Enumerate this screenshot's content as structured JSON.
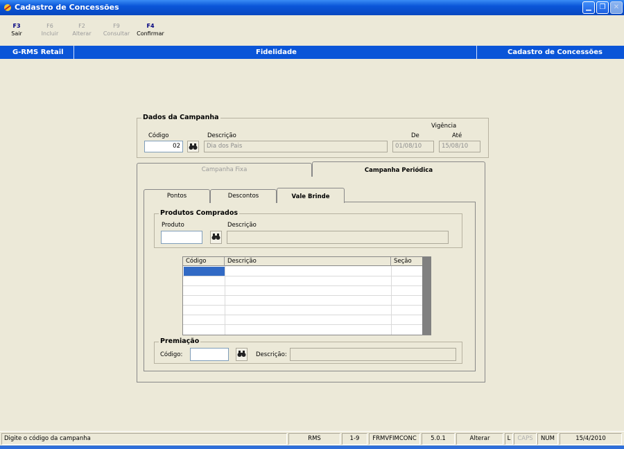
{
  "window": {
    "title": "Cadastro de Concessões"
  },
  "toolbar": {
    "keys": [
      {
        "key": "F3",
        "label": "Sair",
        "enabled": true
      },
      {
        "key": "F6",
        "label": "Incluir",
        "enabled": false
      },
      {
        "key": "F2",
        "label": "Alterar",
        "enabled": false
      },
      {
        "key": "F9",
        "label": "Consultar",
        "enabled": false
      },
      {
        "key": "F4",
        "label": "Confirmar",
        "enabled": true
      }
    ]
  },
  "header": {
    "left": "G-RMS Retail",
    "center": "Fidelidade",
    "right": "Cadastro de Concessões"
  },
  "campaign": {
    "group_title": "Dados da Campanha",
    "codigo_label": "Código",
    "codigo_value": "02",
    "descricao_label": "Descrição",
    "descricao_value": "Dia dos Pais",
    "vigencia_label": "Vigência",
    "de_label": "De",
    "ate_label": "Até",
    "de_value": "01/08/10",
    "ate_value": "15/08/10"
  },
  "tabs": {
    "outer": [
      "Campanha Fixa",
      "Campanha Periódica"
    ],
    "inner": [
      "Pontos",
      "Descontos",
      "Vale Brinde"
    ]
  },
  "produtos": {
    "group_title": "Produtos Comprados",
    "produto_label": "Produto",
    "descricao_label": "Descrição",
    "produto_value": "",
    "descricao_value": ""
  },
  "grid": {
    "columns": [
      "Código",
      "Descrição",
      "Seção"
    ],
    "rows": []
  },
  "premiacao": {
    "group_title": "Premiação",
    "codigo_label": "Código:",
    "descricao_label": "Descrição:",
    "codigo_value": "",
    "descricao_value": ""
  },
  "statusbar": {
    "message": "Digite o código da campanha",
    "system": "RMS",
    "pages": "1-9",
    "form": "FRMVFIMCONC",
    "version": "5.0.1",
    "mode": "Alterar",
    "l": "L",
    "caps": "CAPS",
    "num": "NUM",
    "date": "15/4/2010"
  },
  "colors": {
    "title_blue": "#0a55d8",
    "face": "#ece9d8",
    "selection": "#316ac5"
  }
}
